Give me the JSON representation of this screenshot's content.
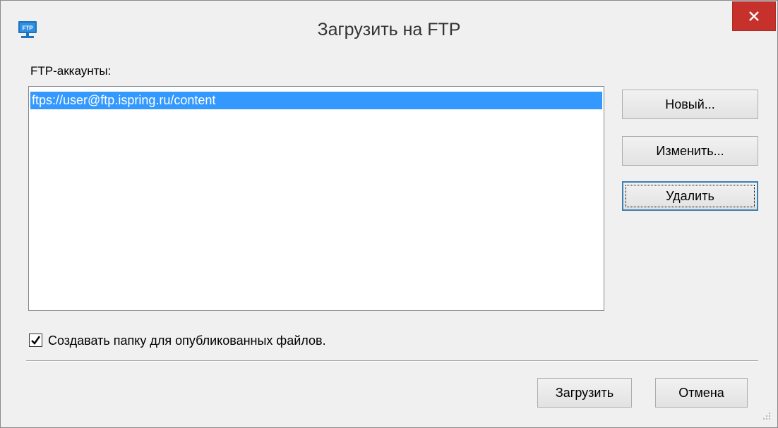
{
  "window": {
    "title": "Загрузить на FTP",
    "app_icon": "ftp-monitor-icon",
    "app_icon_text": "FTP",
    "close_icon": "close-icon"
  },
  "accounts": {
    "label": "FTP-аккаунты:",
    "items": [
      {
        "text": "ftps://user@ftp.ispring.ru/content",
        "selected": true
      }
    ]
  },
  "side_buttons": {
    "new_label": "Новый...",
    "edit_label": "Изменить...",
    "delete_label": "Удалить"
  },
  "options": {
    "create_folder_label": "Создавать папку для опубликованных файлов.",
    "create_folder_checked": true,
    "check_icon": "checkmark-icon"
  },
  "footer": {
    "upload_label": "Загрузить",
    "cancel_label": "Отмена",
    "grip_icon": "resize-grip-icon"
  },
  "colors": {
    "selection": "#3399ff",
    "close_button": "#c7312b",
    "focus_border": "#3c7fb1",
    "dialog_background": "#f0f0f0"
  }
}
